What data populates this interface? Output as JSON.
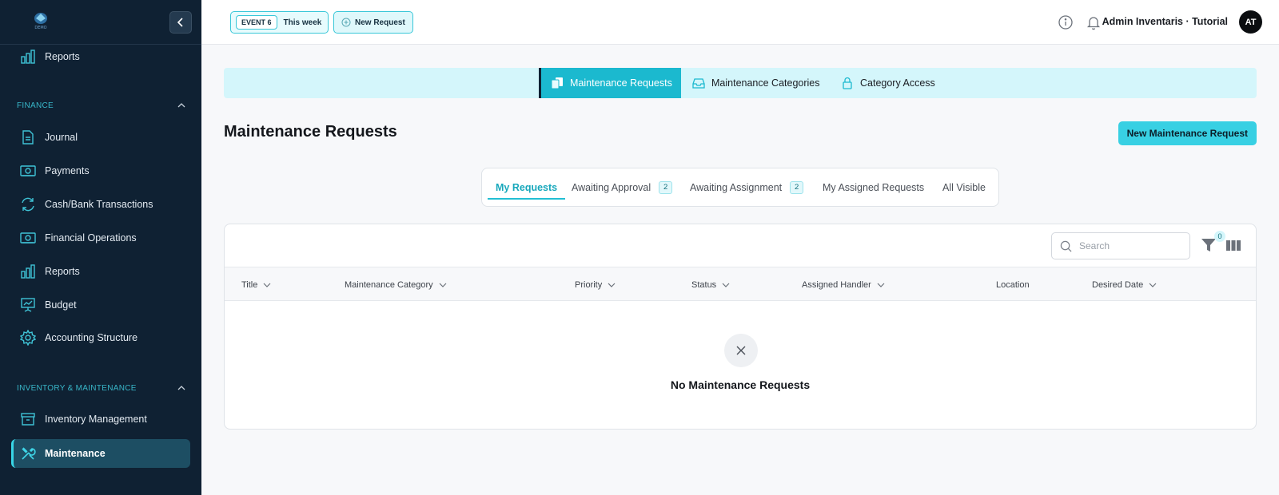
{
  "topbar": {
    "event_tag": "EVENT 6",
    "event_period": "This week",
    "new_request_label": "New Request",
    "user_name": "Admin Inventaris · Tutorial",
    "avatar_initials": "AT",
    "icons": [
      "info-icon",
      "bell-icon"
    ]
  },
  "sidebar": {
    "logo_text": "DEMO",
    "items_top": [
      {
        "label": "Reports",
        "icon": "bar-chart-icon"
      }
    ],
    "finance": {
      "title": "FINANCE",
      "items": [
        {
          "label": "Journal",
          "icon": "document-icon"
        },
        {
          "label": "Payments",
          "icon": "cash-icon"
        },
        {
          "label": "Cash/Bank Transactions",
          "icon": "refresh-icon"
        },
        {
          "label": "Financial Operations",
          "icon": "cash-icon"
        },
        {
          "label": "Reports",
          "icon": "bar-chart-icon"
        },
        {
          "label": "Budget",
          "icon": "presentation-icon"
        },
        {
          "label": "Accounting Structure",
          "icon": "gear-icon"
        }
      ]
    },
    "inventory": {
      "title": "INVENTORY & MAINTENANCE",
      "items": [
        {
          "label": "Inventory Management",
          "icon": "archive-icon"
        },
        {
          "label": "Maintenance",
          "icon": "tools-icon",
          "active": true
        }
      ]
    }
  },
  "module_tabs": [
    {
      "label": "Maintenance Requests",
      "icon": "request-icon",
      "active": true
    },
    {
      "label": "Maintenance Categories",
      "icon": "inbox-icon"
    },
    {
      "label": "Category Access",
      "icon": "lock-icon"
    }
  ],
  "page": {
    "title": "Maintenance Requests",
    "new_button_label": "New Maintenance Request"
  },
  "subtabs": [
    {
      "label": "My Requests",
      "active": true
    },
    {
      "label": "Awaiting Approval",
      "count": "2"
    },
    {
      "label": "Awaiting Assignment",
      "count": "2"
    },
    {
      "label": "My Assigned Requests"
    },
    {
      "label": "All Visible"
    }
  ],
  "table": {
    "search_placeholder": "Search",
    "filter_count": "0",
    "columns": [
      {
        "label": "Title",
        "sortable": true
      },
      {
        "label": "Maintenance Category",
        "sortable": true
      },
      {
        "label": "Priority",
        "sortable": true
      },
      {
        "label": "Status",
        "sortable": true
      },
      {
        "label": "Assigned Handler",
        "sortable": true
      },
      {
        "label": "Location",
        "sortable": false
      },
      {
        "label": "Desired Date",
        "sortable": true
      }
    ],
    "empty_message": "No Maintenance Requests"
  },
  "colors": {
    "sidebar_bg": "#0f2133",
    "accent": "#38d0e3",
    "active_tab": "#1bb9cf",
    "module_nav_bg": "#d4f6fb"
  }
}
